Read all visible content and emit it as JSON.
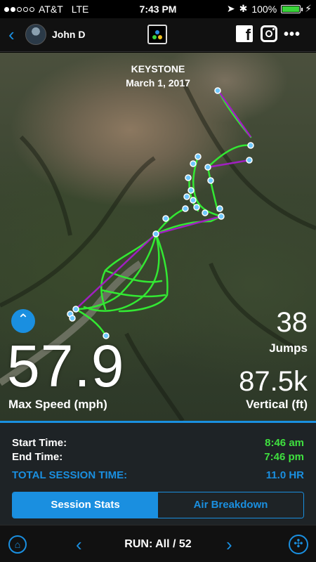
{
  "status_bar": {
    "carrier": "AT&T",
    "network": "LTE",
    "time": "7:43 PM",
    "battery": "100%",
    "battery_level": 1.0
  },
  "header": {
    "back_icon": "chevron-left-icon",
    "user_name": "John D",
    "share_icons": [
      "facebook-icon",
      "instagram-icon",
      "more-icon"
    ]
  },
  "map": {
    "resort_name": "KEYSTONE",
    "date": "March 1, 2017",
    "expand_icon": "chevrons-up-icon",
    "run_color": "#33e833",
    "lift_color": "#a020c0",
    "marker_color": "#6fc8ff"
  },
  "metrics": {
    "max_speed_value": "57.9",
    "max_speed_label": "Max Speed (mph)",
    "jumps_value": "38",
    "jumps_label": "Jumps",
    "vertical_value": "87.5k",
    "vertical_label": "Vertical (ft)"
  },
  "session": {
    "start_label": "Start Time:",
    "start_value": "8:46 am",
    "end_label": "End Time:",
    "end_value": "7:46 pm",
    "total_label": "TOTAL SESSION TIME:",
    "total_value": "11.0 HR"
  },
  "tabs": {
    "session_stats": "Session Stats",
    "air_breakdown": "Air Breakdown",
    "active": "Session Stats"
  },
  "footer": {
    "home_icon": "home-icon",
    "run_label": "RUN: All / 52",
    "compass_icon": "compass-icon"
  },
  "colors": {
    "accent": "#1a8fe0",
    "time_value": "#3fe03f"
  }
}
